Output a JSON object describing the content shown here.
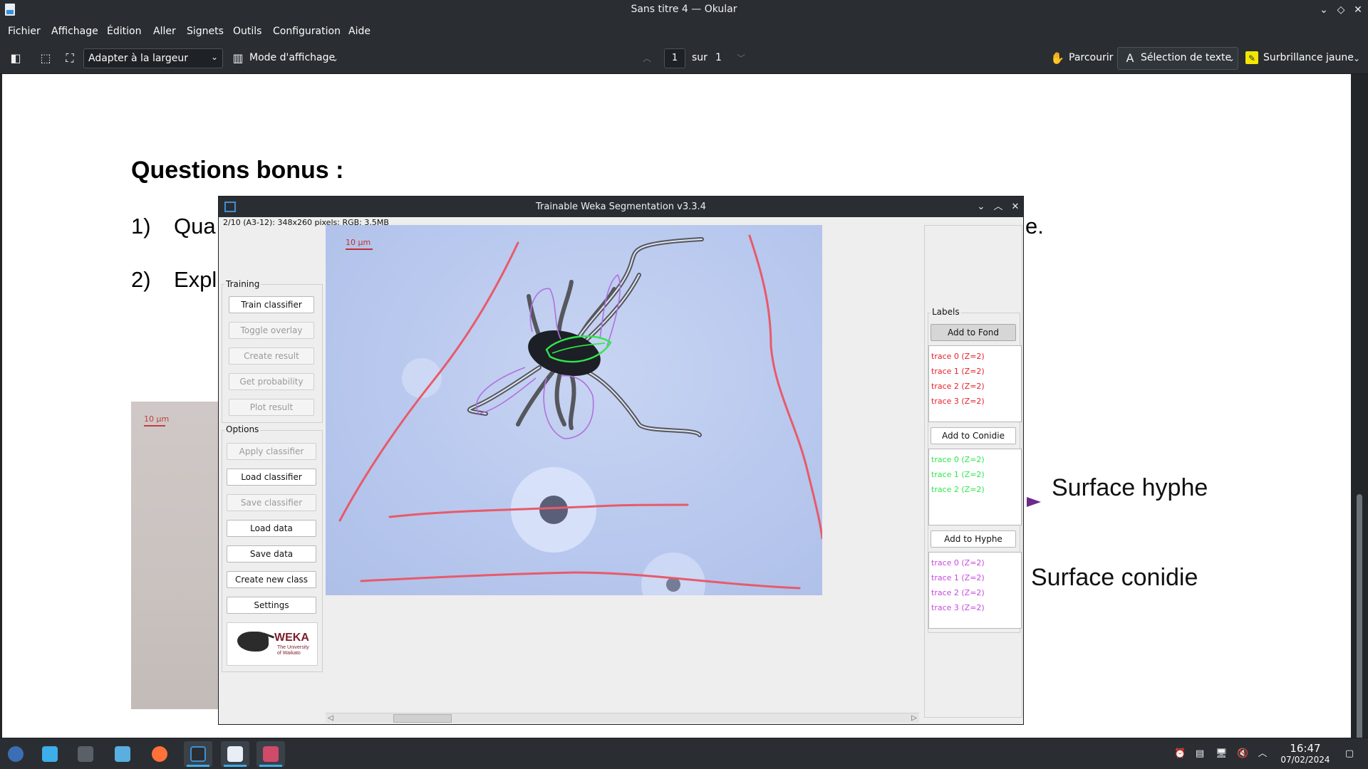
{
  "okular": {
    "title": "Sans titre 4 — Okular",
    "menu": [
      "Fichier",
      "Affichage",
      "Édition",
      "Aller",
      "Signets",
      "Outils",
      "Configuration",
      "Aide"
    ],
    "toolbar": {
      "zoom": "Adapter à la largeur",
      "view_mode": "Mode d'affichage",
      "page_current": "1",
      "page_sep": "sur",
      "page_total": "1",
      "browse": "Parcourir",
      "text_selection": "Sélection de texte",
      "highlight": "Surbrillance jaune"
    },
    "document": {
      "heading": "Questions bonus :",
      "q1_num": "1)",
      "q1_text": "Qua",
      "q1_suffix": "e.",
      "q2_num": "2)",
      "q2_text": "Expl",
      "photo_scale": "10 µm",
      "annotation_hyphe": "Surface hyphe",
      "annotation_conidie": "Surface conidie"
    }
  },
  "weka": {
    "title": "Trainable Weka Segmentation v3.3.4",
    "image_info": "2/10 (A3-12): 348x260 pixels; RGB; 3.5MB",
    "scale_label": "10 µm",
    "training": {
      "title": "Training",
      "buttons": [
        {
          "label": "Train classifier",
          "enabled": true
        },
        {
          "label": "Toggle overlay",
          "enabled": false
        },
        {
          "label": "Create result",
          "enabled": false
        },
        {
          "label": "Get probability",
          "enabled": false
        },
        {
          "label": "Plot result",
          "enabled": false
        }
      ]
    },
    "options": {
      "title": "Options",
      "buttons": [
        {
          "label": "Apply classifier",
          "enabled": false
        },
        {
          "label": "Load classifier",
          "enabled": true
        },
        {
          "label": "Save classifier",
          "enabled": false
        },
        {
          "label": "Load data",
          "enabled": true
        },
        {
          "label": "Save data",
          "enabled": true
        },
        {
          "label": "Create new class",
          "enabled": true
        },
        {
          "label": "Settings",
          "enabled": true
        }
      ]
    },
    "logo": {
      "word": "WEKA",
      "sub": "The University of Waikato"
    },
    "labels": {
      "title": "Labels",
      "classes": [
        {
          "button": "Add to Fond",
          "color": "#e8202a",
          "traces": [
            "trace 0 (Z=2)",
            "trace 1 (Z=2)",
            "trace 2 (Z=2)",
            "trace 3 (Z=2)"
          ]
        },
        {
          "button": "Add to Conidie",
          "color": "#2ee84a",
          "traces": [
            "trace 0 (Z=2)",
            "trace 1 (Z=2)",
            "trace 2 (Z=2)"
          ]
        },
        {
          "button": "Add to Hyphe",
          "color": "#c848e0",
          "traces": [
            "trace 0 (Z=2)",
            "trace 1 (Z=2)",
            "trace 2 (Z=2)",
            "trace 3 (Z=2)"
          ]
        }
      ]
    }
  },
  "taskbar": {
    "time": "16:47",
    "date": "07/02/2024"
  }
}
